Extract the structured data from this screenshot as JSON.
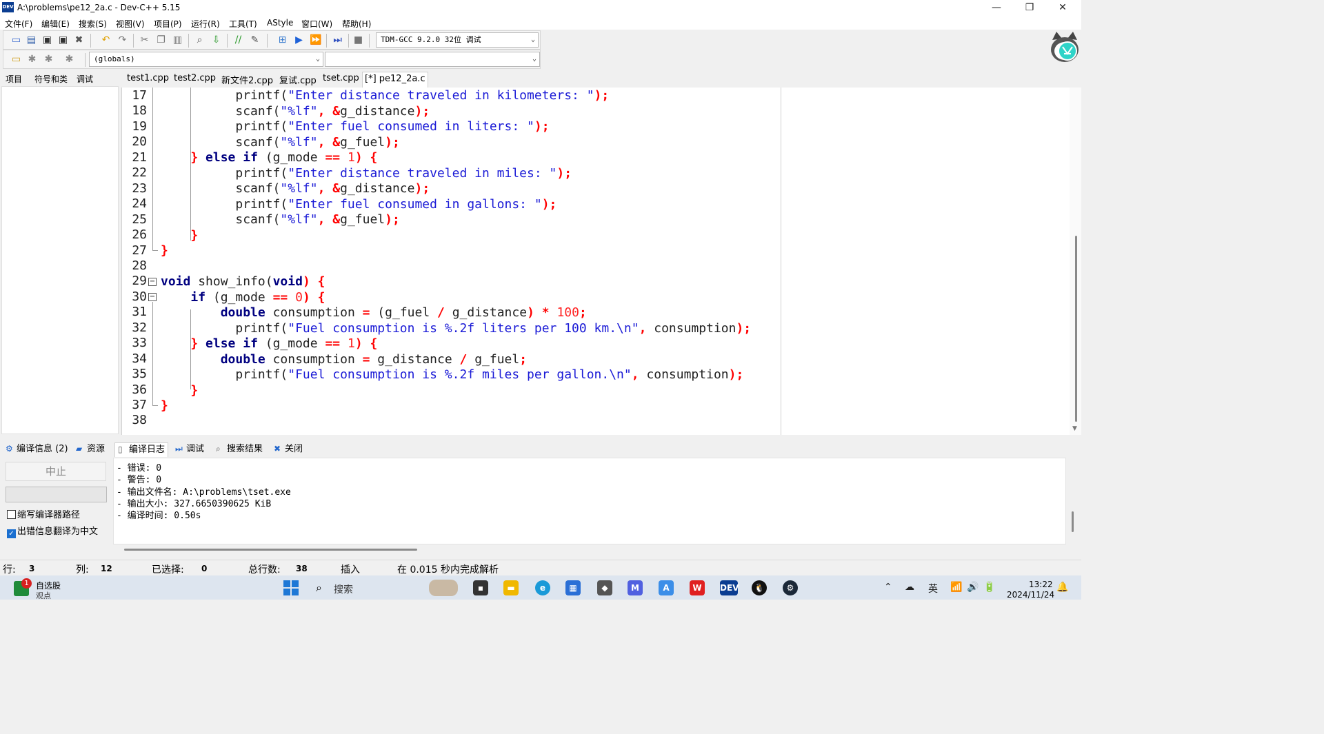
{
  "window": {
    "title": "A:\\problems\\pe12_2a.c - Dev-C++ 5.15",
    "app_icon_text": "DEV",
    "controls": {
      "minimize": "—",
      "maximize": "❐",
      "close": "✕"
    }
  },
  "menu": [
    "文件(F)",
    "编辑(E)",
    "搜索(S)",
    "视图(V)",
    "项目(P)",
    "运行(R)",
    "工具(T)",
    "AStyle",
    "窗口(W)",
    "帮助(H)"
  ],
  "toolbar": {
    "compiler_select": "TDM-GCC 9.2.0 32位 调试",
    "scope_select": "(globals)",
    "function_select": ""
  },
  "left_tabs": [
    "项目",
    "符号和类",
    "调试"
  ],
  "file_tabs": [
    "test1.cpp",
    "test2.cpp",
    "新文件2.cpp",
    "复试.cpp",
    "tset.cpp",
    "[*] pe12_2a.c"
  ],
  "editor": {
    "line_numbers": [
      "17",
      "18",
      "19",
      "20",
      "21",
      "22",
      "23",
      "24",
      "25",
      "26",
      "27",
      "28",
      "29",
      "30",
      "31",
      "32",
      "33",
      "34",
      "35",
      "36",
      "37",
      "38"
    ]
  },
  "bottom_tabs": [
    "编译信息 (2)",
    "资源",
    "编译日志",
    "调试",
    "搜索结果",
    "关闭"
  ],
  "compile_panel": {
    "abort_label": "中止",
    "option_shorten": "缩写编译器路径",
    "option_shorten_checked": false,
    "option_translate": "出错信息翻译为中文",
    "option_translate_checked": true,
    "log_lines": [
      "- 错误: 0",
      "- 警告: 0",
      "- 输出文件名: A:\\problems\\tset.exe",
      "- 输出大小: 327.6650390625 KiB",
      "- 编译时间: 0.50s"
    ]
  },
  "status": {
    "row_label": "行:",
    "row": "3",
    "col_label": "列:",
    "col": "12",
    "sel_label": "已选择:",
    "sel": "0",
    "lines_label": "总行数:",
    "lines": "38",
    "mode": "插入",
    "parse": "在 0.015 秒内完成解析"
  },
  "taskbar": {
    "stock_title": "自选股",
    "stock_sub": "观点",
    "stock_badge": "1",
    "search_placeholder": "搜索",
    "ime": "英",
    "time": "13:22",
    "date": "2024/11/24"
  },
  "colors": {
    "keyword": "#000080",
    "string": "#1a1ad6",
    "number": "#ff2020",
    "operator": "#ff0000"
  }
}
